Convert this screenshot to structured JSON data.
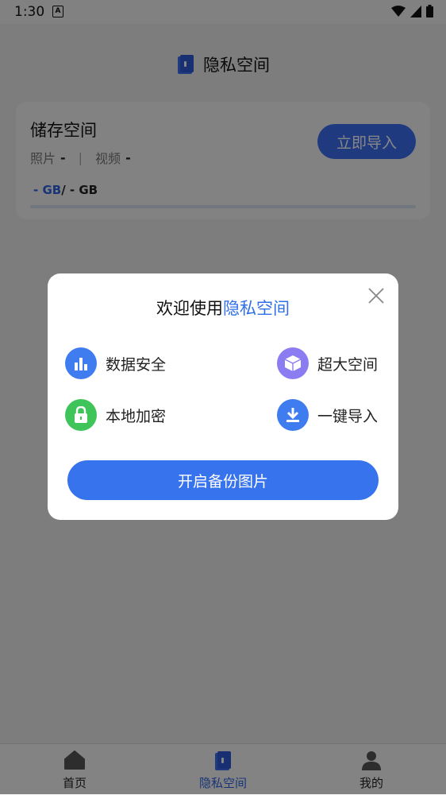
{
  "status_bar": {
    "time": "1:30",
    "notification_icon": "A"
  },
  "header": {
    "title": "隐私空间",
    "icon": "book-icon"
  },
  "storage": {
    "title": "储存空间",
    "photos_label": "照片",
    "photos_value": "-",
    "separator": "|",
    "videos_label": "视频",
    "videos_value": "-",
    "used": "- GB",
    "total": "/ - GB",
    "import_button": "立即导入"
  },
  "dialog": {
    "title_prefix": "欢迎使用",
    "title_highlight": "隐私空间",
    "features": [
      {
        "label": "数据安全",
        "icon": "bar-chart-icon",
        "color": "#3f7cf0"
      },
      {
        "label": "超大空间",
        "icon": "cube-icon",
        "color": "#8b7cf2"
      },
      {
        "label": "本地加密",
        "icon": "lock-icon",
        "color": "#3fc45a"
      },
      {
        "label": "一键导入",
        "icon": "download-icon",
        "color": "#3f7cf0"
      }
    ],
    "primary_button": "开启备份图片"
  },
  "bottom_nav": {
    "items": [
      {
        "label": "首页",
        "icon": "home-icon",
        "active": false
      },
      {
        "label": "隐私空间",
        "icon": "book-icon",
        "active": true
      },
      {
        "label": "我的",
        "icon": "person-icon",
        "active": false
      }
    ]
  },
  "colors": {
    "accent": "#3873ee",
    "overlay": "rgba(0,0,0,0.47)"
  }
}
